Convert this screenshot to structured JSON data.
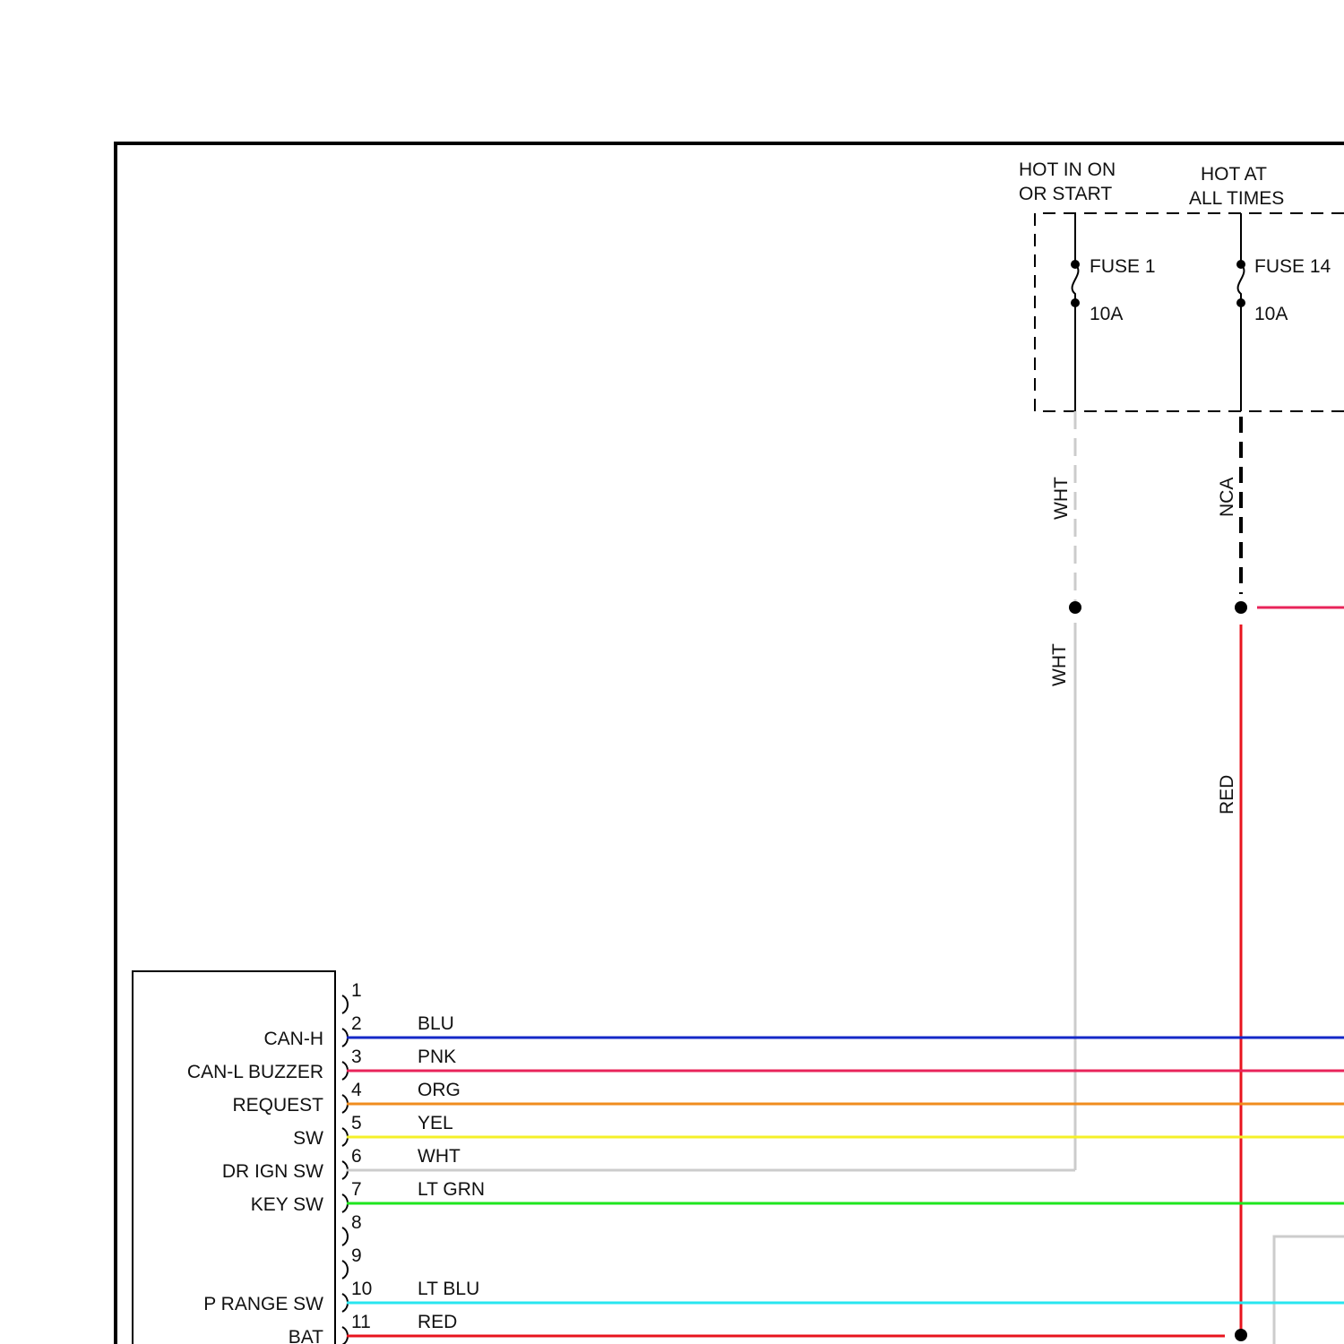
{
  "power": {
    "hot_on_start_line1": "HOT IN ON",
    "hot_on_start_line2": "OR START",
    "hot_all_line1": "HOT AT",
    "hot_all_line2": "ALL TIMES"
  },
  "fuses": [
    {
      "label": "FUSE 1",
      "rating": "10A"
    },
    {
      "label": "FUSE 14",
      "rating": "10A"
    }
  ],
  "vertical_wires": [
    {
      "upper_label": "WHT",
      "lower_label": "WHT",
      "color": "#cccccc"
    },
    {
      "upper_label": "NCA",
      "lower_label": "RED",
      "color": "#e8141e"
    }
  ],
  "module_pins": [
    {
      "num": "1",
      "func": "",
      "wire": "",
      "color": ""
    },
    {
      "num": "2",
      "func": "CAN-H",
      "wire": "BLU",
      "color": "#1428c8"
    },
    {
      "num": "3",
      "func": "CAN-L BUZZER",
      "wire": "PNK",
      "color": "#e8245a"
    },
    {
      "num": "4",
      "func": "REQUEST",
      "wire": "ORG",
      "color": "#f08c1e"
    },
    {
      "num": "5",
      "func": "SW",
      "wire": "YEL",
      "color": "#f5f028"
    },
    {
      "num": "6",
      "func": "DR IGN SW",
      "wire": "WHT",
      "color": "#cccccc"
    },
    {
      "num": "7",
      "func": "KEY SW",
      "wire": "LT GRN",
      "color": "#1ee61e"
    },
    {
      "num": "8",
      "func": "",
      "wire": "",
      "color": ""
    },
    {
      "num": "9",
      "func": "",
      "wire": "",
      "color": ""
    },
    {
      "num": "10",
      "func": "P RANGE SW",
      "wire": "LT BLU",
      "color": "#28e6f0"
    },
    {
      "num": "11",
      "func": "BAT",
      "wire": "RED",
      "color": "#e8141e"
    }
  ],
  "colors": {
    "frame": "#000000",
    "red_feed": "#e8245a",
    "grey_box": "#cccccc"
  }
}
